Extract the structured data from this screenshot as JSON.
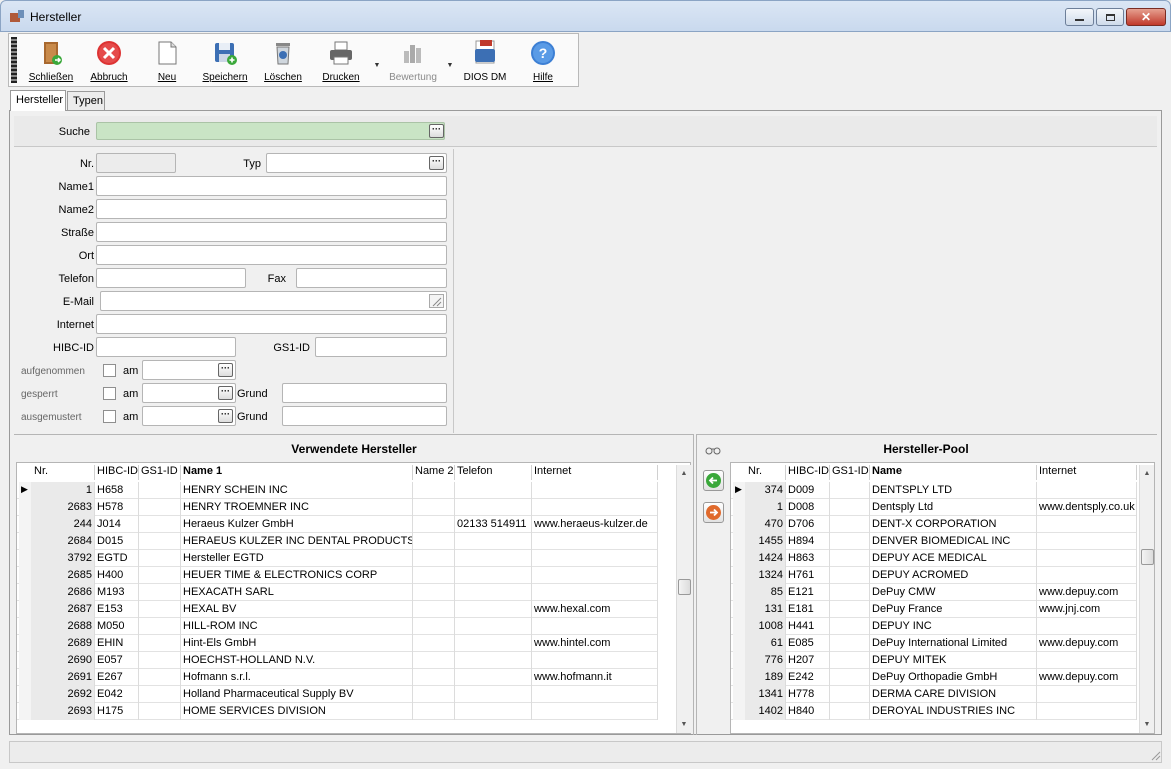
{
  "window": {
    "title": "Hersteller"
  },
  "toolbar": {
    "close_label": "Schließen",
    "abort_label": "Abbruch",
    "new_label": "Neu",
    "save_label": "Speichern",
    "delete_label": "Löschen",
    "print_label": "Drucken",
    "rating_label": "Bewertung",
    "dios_label": "DIOS DM",
    "help_label": "Hilfe"
  },
  "tabs": [
    {
      "label": "Hersteller"
    },
    {
      "label": "Typen"
    }
  ],
  "form": {
    "search_label": "Suche",
    "nr_label": "Nr.",
    "typ_label": "Typ",
    "name1_label": "Name1",
    "name2_label": "Name2",
    "street_label": "Straße",
    "city_label": "Ort",
    "phone_label": "Telefon",
    "fax_label": "Fax",
    "email_label": "E-Mail",
    "internet_label": "Internet",
    "hibc_label": "HIBC-ID",
    "gs1_label": "GS1-ID",
    "admitted_label": "aufgenommen",
    "blocked_label": "gesperrt",
    "retired_label": "ausgemustert",
    "on_label": "am",
    "reason_label": "Grund"
  },
  "left_grid": {
    "title": "Verwendete Hersteller",
    "columns": [
      "Nr.",
      "HIBC-ID",
      "GS1-ID",
      "Name 1",
      "Name 2",
      "Telefon",
      "Internet"
    ],
    "rows": [
      [
        "1",
        "H658",
        "",
        "HENRY SCHEIN INC",
        "",
        "",
        ""
      ],
      [
        "2683",
        "H578",
        "",
        "HENRY TROEMNER INC",
        "",
        "",
        ""
      ],
      [
        "244",
        "J014",
        "",
        "Heraeus Kulzer GmbH",
        "",
        "02133 514911",
        "www.heraeus-kulzer.de"
      ],
      [
        "2684",
        "D015",
        "",
        "HERAEUS KULZER INC DENTAL PRODUCTS",
        "",
        "",
        ""
      ],
      [
        "3792",
        "EGTD",
        "",
        "Hersteller EGTD",
        "",
        "",
        ""
      ],
      [
        "2685",
        "H400",
        "",
        "HEUER TIME & ELECTRONICS CORP",
        "",
        "",
        ""
      ],
      [
        "2686",
        "M193",
        "",
        "HEXACATH SARL",
        "",
        "",
        ""
      ],
      [
        "2687",
        "E153",
        "",
        "HEXAL BV",
        "",
        "",
        "www.hexal.com"
      ],
      [
        "2688",
        "M050",
        "",
        "HILL-ROM INC",
        "",
        "",
        ""
      ],
      [
        "2689",
        "EHIN",
        "",
        "Hint-Els GmbH",
        "",
        "",
        "www.hintel.com"
      ],
      [
        "2690",
        "E057",
        "",
        "HOECHST-HOLLAND N.V.",
        "",
        "",
        ""
      ],
      [
        "2691",
        "E267",
        "",
        "Hofmann s.r.l.",
        "",
        "",
        "www.hofmann.it"
      ],
      [
        "2692",
        "E042",
        "",
        "Holland Pharmaceutical Supply BV",
        "",
        "",
        ""
      ],
      [
        "2693",
        "H175",
        "",
        "HOME SERVICES DIVISION",
        "",
        "",
        ""
      ]
    ]
  },
  "right_grid": {
    "title": "Hersteller-Pool",
    "columns": [
      "Nr.",
      "HIBC-ID",
      "GS1-ID",
      "Name",
      "Internet"
    ],
    "rows": [
      [
        "374",
        "D009",
        "",
        "DENTSPLY LTD",
        ""
      ],
      [
        "1",
        "D008",
        "",
        "Dentsply Ltd",
        "www.dentsply.co.uk"
      ],
      [
        "470",
        "D706",
        "",
        "DENT-X CORPORATION",
        ""
      ],
      [
        "1455",
        "H894",
        "",
        "DENVER BIOMEDICAL INC",
        ""
      ],
      [
        "1424",
        "H863",
        "",
        "DEPUY ACE MEDICAL",
        ""
      ],
      [
        "1324",
        "H761",
        "",
        "DEPUY ACROMED",
        ""
      ],
      [
        "85",
        "E121",
        "",
        "DePuy CMW",
        "www.depuy.com"
      ],
      [
        "131",
        "E181",
        "",
        "DePuy France",
        "www.jnj.com"
      ],
      [
        "1008",
        "H441",
        "",
        "DEPUY INC",
        ""
      ],
      [
        "61",
        "E085",
        "",
        "DePuy International Limited",
        "www.depuy.com"
      ],
      [
        "776",
        "H207",
        "",
        "DEPUY MITEK",
        ""
      ],
      [
        "189",
        "E242",
        "",
        "DePuy Orthopadie GmbH",
        "www.depuy.com"
      ],
      [
        "1341",
        "H778",
        "",
        "DERMA CARE DIVISION",
        ""
      ],
      [
        "1402",
        "H840",
        "",
        "DEROYAL INDUSTRIES INC",
        ""
      ]
    ]
  },
  "colors": {
    "search_bg": "#c9e4c5",
    "accent": "#3c6fb4"
  }
}
